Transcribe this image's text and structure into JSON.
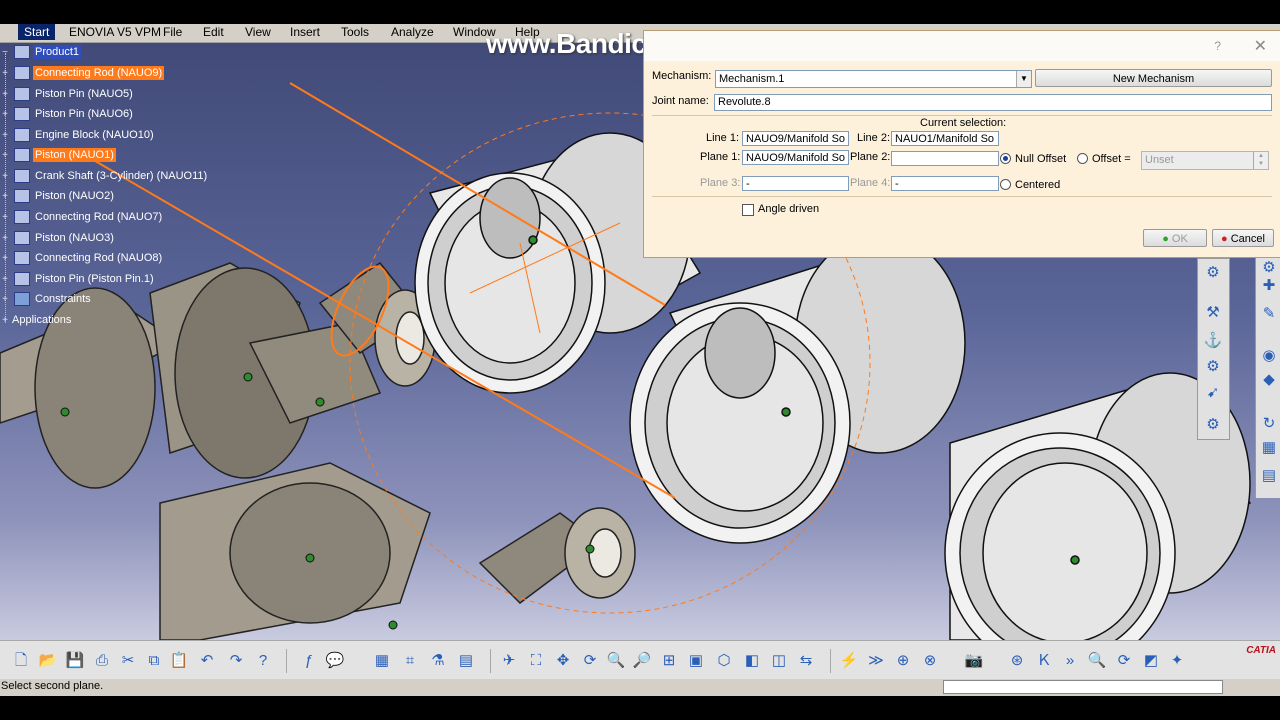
{
  "menu": {
    "start": "Start",
    "items": [
      "ENOVIA V5 VPM",
      "File",
      "Edit",
      "View",
      "Insert",
      "Tools",
      "Analyze",
      "Window",
      "Help"
    ]
  },
  "tree": {
    "root": "Product1",
    "items": [
      {
        "label": "Connecting Rod (NAUO9)",
        "highlight": true
      },
      {
        "label": "Piston Pin (NAUO5)",
        "highlight": false
      },
      {
        "label": "Piston Pin (NAUO6)",
        "highlight": false
      },
      {
        "label": "Engine Block (NAUO10)",
        "highlight": false
      },
      {
        "label": "Piston (NAUO1)",
        "highlight": true
      },
      {
        "label": "Crank Shaft (3-Cylinder) (NAUO11)",
        "highlight": false
      },
      {
        "label": "Piston (NAUO2)",
        "highlight": false
      },
      {
        "label": "Connecting Rod (NAUO7)",
        "highlight": false
      },
      {
        "label": "Piston (NAUO3)",
        "highlight": false
      },
      {
        "label": "Connecting Rod (NAUO8)",
        "highlight": false
      },
      {
        "label": "Piston Pin (Piston Pin.1)",
        "highlight": false
      },
      {
        "label": "Constraints",
        "highlight": false
      }
    ],
    "applications": "Applications"
  },
  "watermark": "www.Bandicam.com",
  "dialog": {
    "help_glyph": "?",
    "close_glyph": "✕",
    "mechanism_label": "Mechanism:",
    "mechanism_value": "Mechanism.1",
    "new_mechanism": "New Mechanism",
    "joint_name_label": "Joint name:",
    "joint_name_value": "Revolute.8",
    "current_selection": "Current selection:",
    "line1_label": "Line 1:",
    "line1_value": "NAUO9/Manifold So",
    "line2_label": "Line 2:",
    "line2_value": "NAUO1/Manifold So",
    "plane1_label": "Plane 1:",
    "plane1_value": "NAUO9/Manifold So",
    "plane2_label": "Plane 2:",
    "plane2_value": "",
    "null_offset": "Null Offset",
    "offset_label": "Offset =",
    "offset_value": "Unset",
    "plane3_label": "Plane 3:",
    "plane3_value": "-",
    "plane4_label": "Plane 4:",
    "plane4_value": "-",
    "centered": "Centered",
    "angle_driven": "Angle driven",
    "ok": "OK",
    "cancel": "Cancel"
  },
  "status": {
    "text": "Select second plane."
  },
  "logo": "CATIA",
  "colors": {
    "selection_orange": "#ff7a1a",
    "viewport_top": "#414a78",
    "viewport_bottom": "#c9cbe0",
    "dialog_bg": "#fdf1dc"
  }
}
